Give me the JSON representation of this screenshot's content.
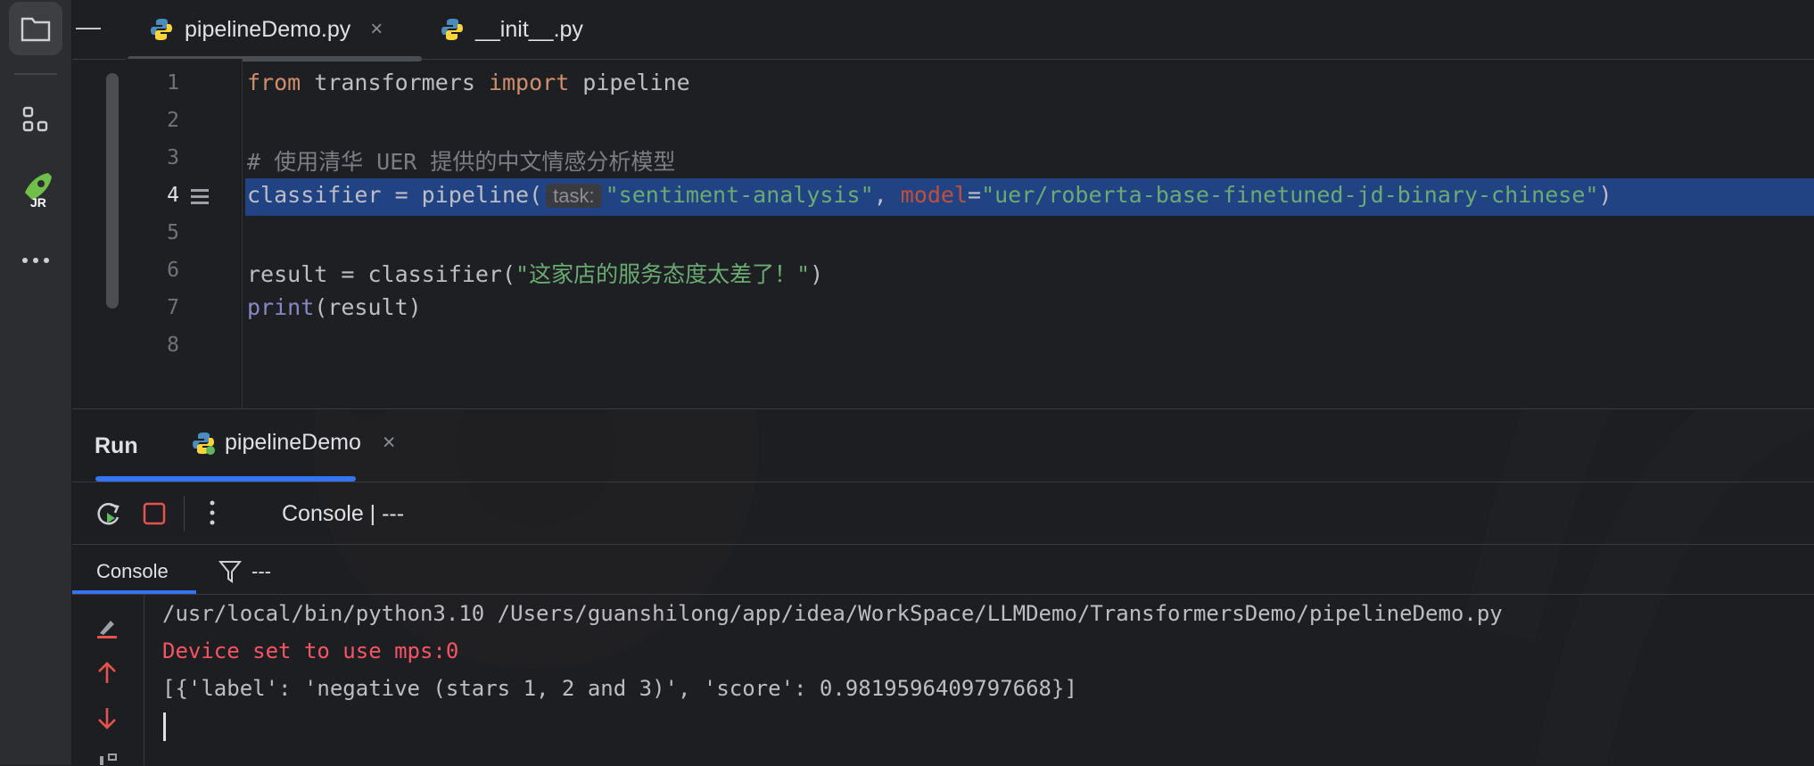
{
  "tabs": [
    {
      "label": "pipelineDemo.py",
      "close": "×",
      "icon": "python-icon"
    },
    {
      "label": "__init__.py",
      "icon": "python-icon"
    }
  ],
  "window_minimize": "—",
  "editor": {
    "line_numbers": [
      "1",
      "2",
      "3",
      "4",
      "5",
      "6",
      "7",
      "8"
    ],
    "active_line": "4",
    "line1": {
      "kw1": "from",
      "mod": " transformers ",
      "kw2": "import",
      "rest": " pipeline"
    },
    "line3": "# 使用清华 UER 提供的中文情感分析模型",
    "line4": {
      "pre": "classifier = pipeline(",
      "hint": "task:",
      "arg1": "\"sentiment-analysis\"",
      "comma": ", ",
      "kwarg": "model",
      "eq": "=",
      "arg2": "\"uer/roberta-base-finetuned-jd-binary-chinese\"",
      "close": ")"
    },
    "line6": {
      "pre": "result = classifier(",
      "str": "\"这家店的服务态度太差了！\"",
      "close": ")"
    },
    "line7": {
      "fn": "print",
      "rest": "(result)"
    }
  },
  "run_panel": {
    "title": "Run",
    "config_name": "pipelineDemo",
    "config_close": "×",
    "toolbar_label": "Console | ---",
    "console_tab": "Console",
    "filter_text": "---",
    "output": [
      "/usr/local/bin/python3.10 /Users/guanshilong/app/idea/WorkSpace/LLMDemo/TransformersDemo/pipelineDemo.py",
      "Device set to use mps:0",
      "[{'label': 'negative (stars 1, 2 and 3)', 'score': 0.9819596409797668}]"
    ]
  },
  "colors": {
    "selection": "#214283",
    "accent": "#3574f0",
    "error": "#f75464",
    "string": "#6aab73",
    "keyword": "#cf8e6d"
  }
}
